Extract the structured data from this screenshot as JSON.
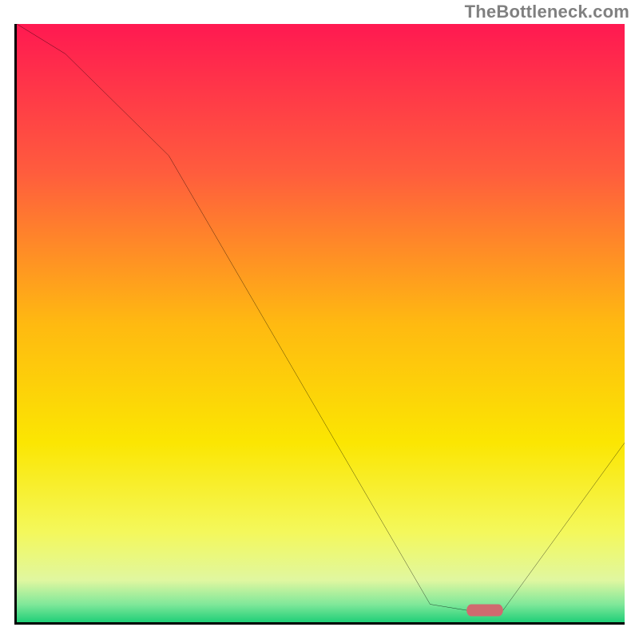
{
  "attribution": "TheBottleneck.com",
  "chart_data": {
    "type": "line",
    "title": "",
    "xlabel": "",
    "ylabel": "",
    "xlim": [
      0,
      100
    ],
    "ylim": [
      0,
      100
    ],
    "series": [
      {
        "name": "bottleneck-curve",
        "x": [
          0,
          8,
          25,
          68,
          74,
          80,
          100
        ],
        "values": [
          100,
          95,
          78,
          3,
          2,
          2,
          30
        ]
      }
    ],
    "marker": {
      "x": 77,
      "y": 2,
      "color": "#d06a6f"
    },
    "background_gradient_stops": [
      {
        "offset": 0.0,
        "color": "#ff1951"
      },
      {
        "offset": 0.25,
        "color": "#ff5d3d"
      },
      {
        "offset": 0.5,
        "color": "#ffb911"
      },
      {
        "offset": 0.7,
        "color": "#fbe602"
      },
      {
        "offset": 0.85,
        "color": "#f4f85c"
      },
      {
        "offset": 0.93,
        "color": "#e0f7a0"
      },
      {
        "offset": 0.97,
        "color": "#80e89a"
      },
      {
        "offset": 1.0,
        "color": "#20cf78"
      }
    ]
  }
}
